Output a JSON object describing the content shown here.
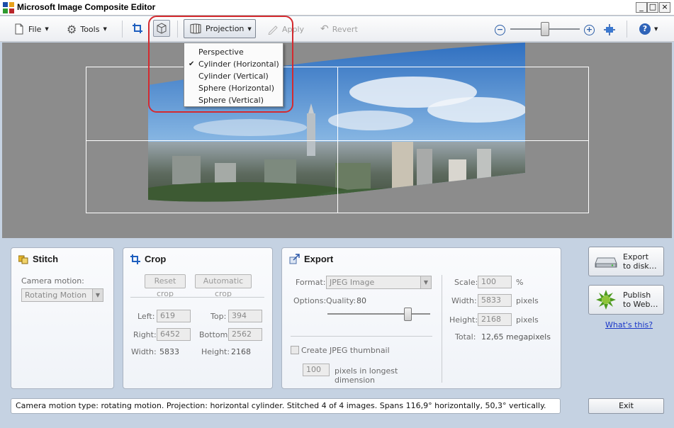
{
  "window": {
    "title": "Microsoft Image Composite Editor",
    "controls": [
      "_",
      "□",
      "×"
    ]
  },
  "toolbar": {
    "file_label": "File",
    "tools_label": "Tools",
    "projection_label": "Projection",
    "apply_label": "Apply",
    "revert_label": "Revert",
    "zoom_out_symbol": "−",
    "zoom_in_symbol": "+",
    "help_symbol": "?"
  },
  "projection_menu": {
    "items": [
      {
        "label": "Perspective",
        "checked": false
      },
      {
        "label": "Cylinder (Horizontal)",
        "checked": true
      },
      {
        "label": "Cylinder (Vertical)",
        "checked": false
      },
      {
        "label": "Sphere (Horizontal)",
        "checked": false
      },
      {
        "label": "Sphere (Vertical)",
        "checked": false
      }
    ],
    "check_mark": "✔"
  },
  "stitch": {
    "title": "Stitch",
    "camera_motion_label": "Camera motion:",
    "camera_motion_value": "Rotating Motion"
  },
  "crop": {
    "title": "Crop",
    "reset_label": "Reset crop",
    "auto_label": "Automatic crop",
    "left_label": "Left:",
    "left_value": "619",
    "top_label": "Top:",
    "top_value": "394",
    "right_label": "Right:",
    "right_value": "6452",
    "bottom_label": "Bottom:",
    "bottom_value": "2562",
    "width_label": "Width:",
    "width_value": "5833",
    "height_label": "Height:",
    "height_value": "2168"
  },
  "export": {
    "title": "Export",
    "format_label": "Format:",
    "format_value": "JPEG Image",
    "options_label": "Options:",
    "quality_label": "Quality:",
    "quality_value": "80",
    "thumbnail_label": "Create JPEG thumbnail",
    "thumb_size_value": "100",
    "thumb_text_1": "pixels in longest",
    "thumb_text_2": "dimension",
    "scale_label": "Scale:",
    "scale_value": "100",
    "scale_unit": "%",
    "width_label": "Width:",
    "width_value": "5833",
    "width_unit": "pixels",
    "height_label": "Height:",
    "height_value": "2168",
    "height_unit": "pixels",
    "total_label": "Total:",
    "total_value": "12,65 megapixels"
  },
  "actions": {
    "export_disk_1": "Export",
    "export_disk_2": "to disk…",
    "publish_web_1": "Publish",
    "publish_web_2": "to Web…",
    "whats_this": "What's this?",
    "exit_label": "Exit"
  },
  "status": {
    "text": "Camera motion type: rotating motion. Projection: horizontal cylinder. Stitched 4 of 4 images. Spans 116,9° horizontally, 50,3° vertically."
  }
}
